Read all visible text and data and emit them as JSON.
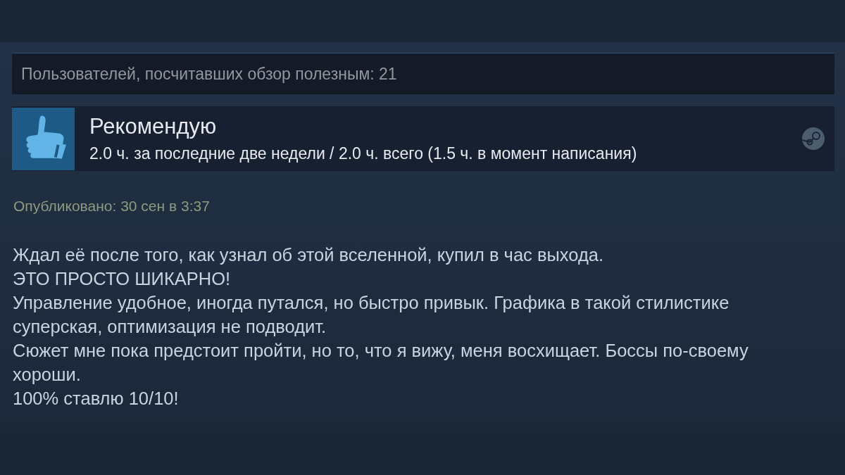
{
  "helpful": {
    "text": "Пользователей, посчитавших обзор полезным: 21"
  },
  "verdict": {
    "kind": "recommended",
    "label": "Рекомендую",
    "hours": "2.0 ч. за последние две недели / 2.0 ч. всего (1.5 ч. в момент написания)"
  },
  "posted": "Опубликовано: 30 сен в 3:37",
  "review_lines": [
    "Ждал её после того, как узнал об этой вселенной, купил в час выхода.",
    "ЭТО ПРОСТО ШИКАРНО!",
    "Управление удобное, иногда путался, но быстро привык. Графика в такой стилистике суперская, оптимизация не подводит.",
    "Сюжет мне пока предстоит пройти, но то, что я вижу, меня восхищает. Боссы по-своему хороши.",
    "100% ставлю 10/10!"
  ]
}
